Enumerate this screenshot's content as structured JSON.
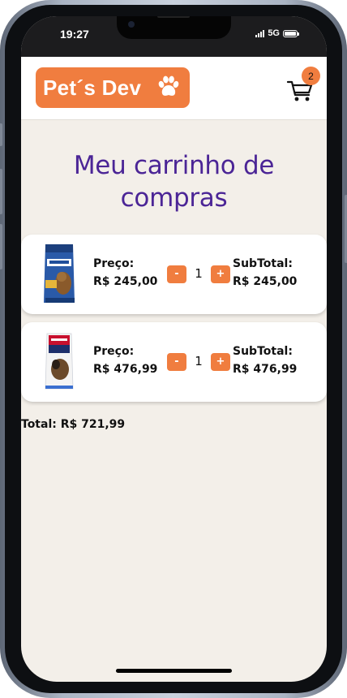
{
  "status_bar": {
    "time": "19:27",
    "network": "5G"
  },
  "header": {
    "logo_text": "Pet´s Dev",
    "logo_icon": "paw-icon",
    "cart_icon": "cart-icon",
    "cart_count": "2"
  },
  "page": {
    "title_line1": "Meu carrinho de",
    "title_line2": "compras"
  },
  "cart": {
    "items": [
      {
        "image_icon": "premier-dog-food-bag",
        "price_label": "Preço:",
        "price": "R$ 245,00",
        "minus_label": "-",
        "quantity": "1",
        "plus_label": "+",
        "subtotal_label": "SubTotal:",
        "subtotal": "R$ 245,00"
      },
      {
        "image_icon": "royal-canin-dog-food-bag",
        "price_label": "Preço:",
        "price": "R$ 476,99",
        "minus_label": "-",
        "quantity": "1",
        "plus_label": "+",
        "subtotal_label": "SubTotal:",
        "subtotal": "R$ 476,99"
      }
    ],
    "total": "Total: R$ 721,99"
  },
  "colors": {
    "brand_orange": "#f07d3f",
    "title_purple": "#4b2596",
    "page_background": "#f3efe9"
  }
}
